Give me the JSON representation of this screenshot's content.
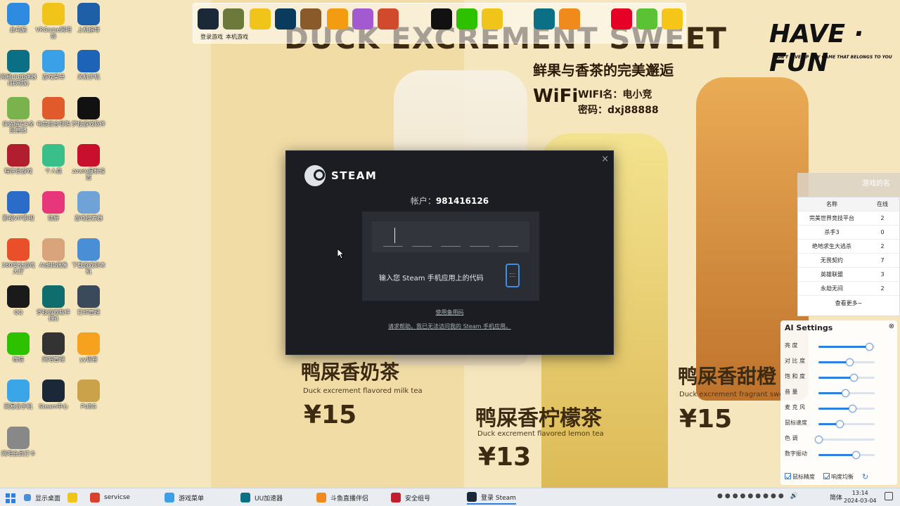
{
  "desktop_icons": [
    {
      "label": "此电脑",
      "icon": "computer-icon",
      "color": "#2f8be0"
    },
    {
      "label": "VRGame网吧版",
      "icon": "vr-icon",
      "color": "#f0c419"
    },
    {
      "label": "上机指导",
      "icon": "guide-icon",
      "color": "#1e5fa8"
    },
    {
      "label": "网易UU加速器(联网版)",
      "icon": "uu-icon",
      "color": "#0b6f86"
    },
    {
      "label": "游戏菜单",
      "icon": "cloud-icon",
      "color": "#3aa0e8"
    },
    {
      "label": "关机手机",
      "icon": "power-icon",
      "color": "#1d63b8"
    },
    {
      "label": "侠盗猎车5全民直播",
      "icon": "gta-icon",
      "color": "#7ab24e"
    },
    {
      "label": "电竞综合导购",
      "icon": "shop-icon",
      "color": "#e05a2b"
    },
    {
      "label": "罗技游戏软件",
      "icon": "logitech-icon",
      "color": "#111111"
    },
    {
      "label": "程序员游戏",
      "icon": "game-icon",
      "color": "#b01e2f"
    },
    {
      "label": "个人盘",
      "icon": "disk-icon",
      "color": "#39c08a"
    },
    {
      "label": "zowie鼠标设置",
      "icon": "zowie-icon",
      "color": "#c8102e"
    },
    {
      "label": "影视VIP影视",
      "icon": "film-icon",
      "color": "#2a6cc7"
    },
    {
      "label": "锁屏",
      "icon": "lock-icon",
      "color": "#e8367b"
    },
    {
      "label": "游戏搜索器",
      "icon": "magnifier-icon",
      "color": "#6fa3d8"
    },
    {
      "label": "360安全游戏大厅",
      "icon": "360-icon",
      "color": "#e94f2a"
    },
    {
      "label": "AI虚拟偶像",
      "icon": "avatar-icon",
      "color": "#d9a37c"
    },
    {
      "label": "下载游戏到本机",
      "icon": "person-icon",
      "color": "#4a8fd6"
    },
    {
      "label": "QQ",
      "icon": "qq-icon",
      "color": "#1a1a1a"
    },
    {
      "label": "罗技游戏软件(新)",
      "icon": "g-hub-icon",
      "color": "#0f6d6d"
    },
    {
      "label": "打印管理",
      "icon": "printer-icon",
      "color": "#3b4a5a"
    },
    {
      "label": "微信",
      "icon": "wechat-icon",
      "color": "#2dc100"
    },
    {
      "label": "网吧管理",
      "icon": "mask-icon",
      "color": "#333333"
    },
    {
      "label": "yy语音",
      "icon": "yy-icon",
      "color": "#f6a21e"
    },
    {
      "label": "网易云手机",
      "icon": "gamepad-icon",
      "color": "#3aa6e8"
    },
    {
      "label": "Steam中心",
      "icon": "steam-icon",
      "color": "#1b2838"
    },
    {
      "label": "PUBG",
      "icon": "pubg-icon",
      "color": "#c9a24a"
    },
    {
      "label": "网吧会员打卡",
      "icon": "card-icon",
      "color": "#888888"
    }
  ],
  "top_launcher": {
    "icons": [
      {
        "icon": "steam-icon",
        "color": "#1b2838",
        "label": "登录游戏"
      },
      {
        "icon": "shield-icon",
        "color": "#6b7a3a",
        "label": "本机游戏"
      },
      {
        "icon": "g-icon",
        "color": "#f0c419"
      },
      {
        "icon": "lol-icon",
        "color": "#0a3a5c"
      },
      {
        "icon": "hero-icon",
        "color": "#8a5a2b"
      },
      {
        "icon": "overwatch-icon",
        "color": "#f39c12"
      },
      {
        "icon": "fan-icon",
        "color": "#a35ad1"
      },
      {
        "icon": "football-icon",
        "color": "#d14a2b"
      },
      {
        "icon": "qq-icon",
        "color": "#111111"
      },
      {
        "icon": "wechat-icon",
        "color": "#2dc100"
      },
      {
        "icon": "chat-icon",
        "color": "#f0c419"
      },
      {
        "icon": "uu-icon",
        "color": "#0b6f86"
      },
      {
        "icon": "douyu-icon",
        "color": "#f08a1d"
      },
      {
        "icon": "netease-music-icon",
        "color": "#e60026"
      },
      {
        "icon": "video-icon",
        "color": "#5bc236"
      },
      {
        "icon": "penguin-icon",
        "color": "#f5c518"
      }
    ]
  },
  "poster": {
    "title": "DUCK EXCREMENT SWEET",
    "subtitle": "鲜果与香茶的完美邂逅",
    "brand": "HAVE · FUN",
    "brand_tag": "DON'T GIVE UP ANY GAME THAT BELONGS TO YOU",
    "wifi_logo": "WiFi",
    "wifi_name": "WIFI名：电小竞",
    "wifi_pass": "密码：dxj88888",
    "menu": [
      {
        "name": "鸭屎香奶茶",
        "en": "Duck excrement flavored milk tea",
        "price": "¥15"
      },
      {
        "name": "鸭屎香柠檬茶",
        "en": "Duck excrement flavored lemon tea",
        "price": "¥13"
      },
      {
        "name": "鸭屎香甜橙",
        "en": "Duck excrement fragrant sweet",
        "price": "¥15"
      }
    ]
  },
  "steam_dialog": {
    "brand": "STEAM",
    "account_label": "帐户：",
    "account_value": "981416126",
    "code_hint": "输入您 Steam 手机应用上的代码",
    "backup_link": "使用备用码",
    "help_link": "请求帮助。我已无法访问我的 Steam 手机应用。",
    "close": "×",
    "accent": "#3c8ee6"
  },
  "online_panel": {
    "header_label": "游戏的名",
    "col_name": "名称",
    "col_count": "在线",
    "rows": [
      {
        "name": "完美世界竞技平台",
        "count": "2"
      },
      {
        "name": "杀手3",
        "count": "0"
      },
      {
        "name": "绝地求生大逃杀",
        "count": "2"
      },
      {
        "name": "无畏契约",
        "count": "7"
      },
      {
        "name": "英雄联盟",
        "count": "3"
      },
      {
        "name": "永劫无间",
        "count": "2"
      }
    ],
    "more": "查看更多~"
  },
  "ai_settings": {
    "title": "AI Settings",
    "close": "⊗",
    "sliders": [
      {
        "label": "亮 度",
        "value": 0.9
      },
      {
        "label": "对 比 度",
        "value": 0.55
      },
      {
        "label": "饱 和 度",
        "value": 0.62
      },
      {
        "label": "音 量",
        "value": 0.48
      },
      {
        "label": "麦 克 风",
        "value": 0.6
      },
      {
        "label": "鼠标速度",
        "value": 0.38
      },
      {
        "label": "色 调",
        "value": 0.0
      },
      {
        "label": "数字振动",
        "value": 0.66
      }
    ],
    "check1": "鼠标精度",
    "check2": "响度均衡"
  },
  "taskbar": {
    "show_desktop": "显示桌面",
    "items": [
      {
        "label": "servicse",
        "color": "#d9412b"
      },
      {
        "label": "游戏菜单",
        "color": "#3aa0e8"
      },
      {
        "label": "UU加速器",
        "color": "#0b6f86"
      },
      {
        "label": "斗鱼直播伴侣",
        "color": "#f08a1d"
      },
      {
        "label": "安全组号",
        "color": "#c21f2e"
      },
      {
        "label": "登录 Steam",
        "color": "#1b2838"
      }
    ],
    "lang": "简体",
    "time": "13:14",
    "date": "2024-03-04"
  }
}
